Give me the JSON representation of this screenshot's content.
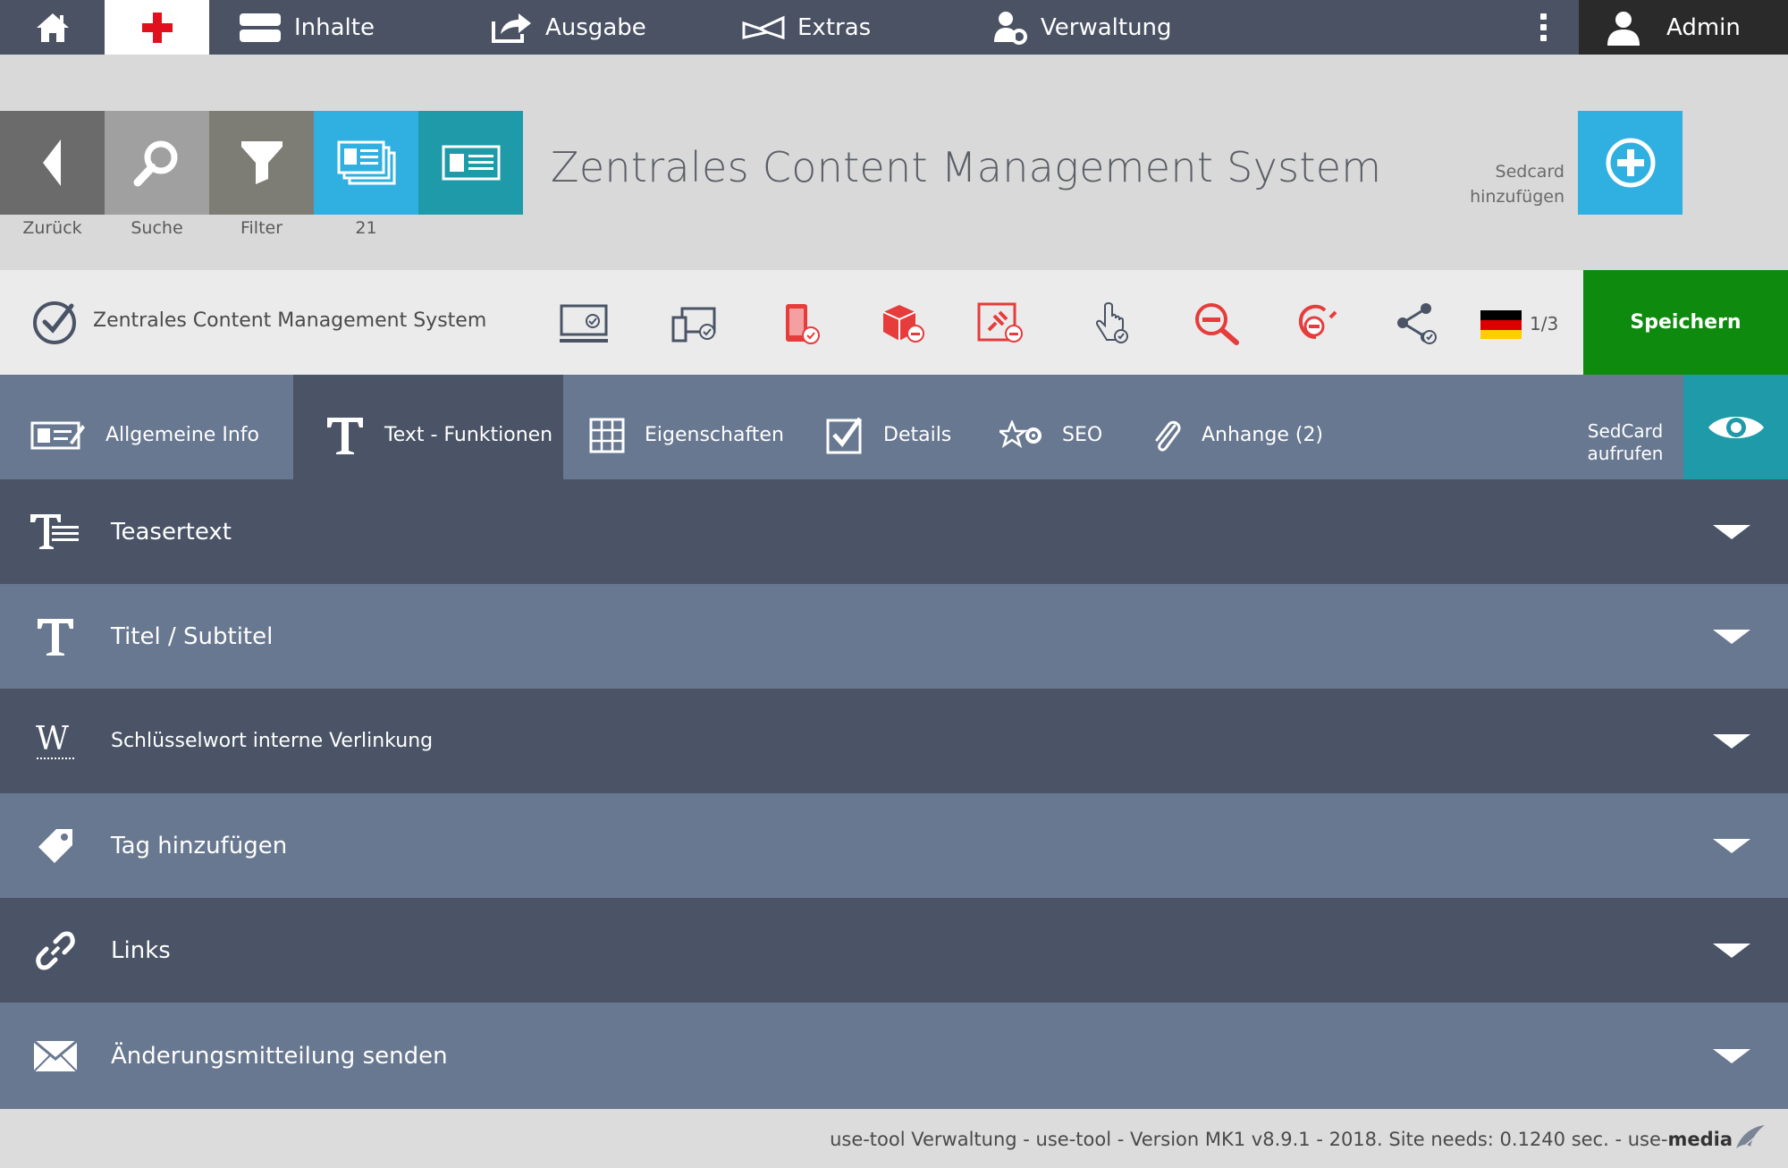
{
  "topbar": {
    "home_icon": "home-icon",
    "active_icon": "red-cross-icon",
    "menu": [
      {
        "label": "Inhalte",
        "icon": "layers-icon"
      },
      {
        "label": "Ausgabe",
        "icon": "export-icon"
      },
      {
        "label": "Extras",
        "icon": "extras-icon"
      },
      {
        "label": "Verwaltung",
        "icon": "user-gear-icon"
      }
    ],
    "user": "Admin"
  },
  "header": {
    "buttons": [
      {
        "label": "Zurück",
        "icon": "chevron-left-icon",
        "color": "#6b6b6b"
      },
      {
        "label": "Suche",
        "icon": "search-icon",
        "color": "#a0a0a0"
      },
      {
        "label": "Filter",
        "icon": "filter-icon",
        "color": "#7d7d75"
      },
      {
        "label": "21",
        "icon": "cards-icon",
        "color": "#2fb0e0"
      },
      {
        "label": "",
        "icon": "card-icon",
        "color": "#1f9aa8"
      }
    ],
    "title": "Zentrales Content Management System",
    "add_label_1": "Sedcard",
    "add_label_2": "hinzufügen"
  },
  "toolbar": {
    "title": "Zentrales Content Management System",
    "page": "1/3",
    "save": "Speichern",
    "icons": [
      "monitor-check-icon",
      "devices-check-icon",
      "mobile-red-icon",
      "box-red-icon",
      "pin-red-icon",
      "hand-pointer-icon",
      "zoom-out-red-icon",
      "unlink-red-icon",
      "share-icon",
      "flag-de-icon"
    ]
  },
  "tabs": [
    {
      "label": "Allgemeine Info",
      "icon": "info-card-icon"
    },
    {
      "label": "Text - Funktionen",
      "icon": "text-icon"
    },
    {
      "label": "Eigenschaften",
      "icon": "grid-icon"
    },
    {
      "label": "Details",
      "icon": "checkbox-icon"
    },
    {
      "label": "SEO",
      "icon": "star-gear-icon"
    },
    {
      "label": "Anhange (2)",
      "icon": "paperclip-icon"
    }
  ],
  "tab_eye": {
    "label_1": "SedCard",
    "label_2": "aufrufen"
  },
  "sections": [
    {
      "label": "Teasertext",
      "icon": "teaser-text-icon"
    },
    {
      "label": "Titel / Subtitel",
      "icon": "title-icon"
    },
    {
      "label": "Schlüsselwort interne Verlinkung",
      "icon": "keyword-icon"
    },
    {
      "label": "Tag hinzufügen",
      "icon": "tag-icon"
    },
    {
      "label": "Links",
      "icon": "link-icon"
    },
    {
      "label": "Änderungsmitteilung senden",
      "icon": "envelope-icon"
    }
  ],
  "footer": {
    "text": "use-tool Verwaltung - use-tool - Version MK1 v8.9.1 - 2018. Site needs: 0.1240 sec. - use-",
    "brand": "media"
  }
}
